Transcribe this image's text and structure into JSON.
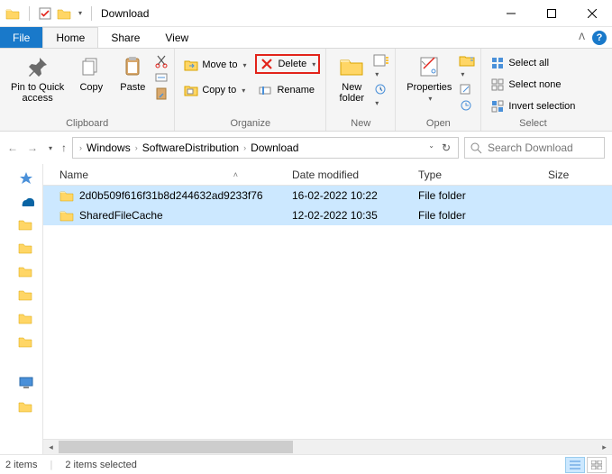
{
  "window": {
    "title": "Download"
  },
  "tabs": {
    "file": "File",
    "home": "Home",
    "share": "Share",
    "view": "View"
  },
  "ribbon": {
    "clipboard": {
      "label": "Clipboard",
      "pin": "Pin to Quick\naccess",
      "copy": "Copy",
      "paste": "Paste"
    },
    "organize": {
      "label": "Organize",
      "move_to": "Move to",
      "copy_to": "Copy to",
      "delete": "Delete",
      "rename": "Rename"
    },
    "new": {
      "label": "New",
      "new_folder": "New\nfolder"
    },
    "open": {
      "label": "Open",
      "properties": "Properties"
    },
    "select": {
      "label": "Select",
      "select_all": "Select all",
      "select_none": "Select none",
      "invert": "Invert selection"
    }
  },
  "breadcrumb": {
    "parts": [
      "Windows",
      "SoftwareDistribution",
      "Download"
    ]
  },
  "search": {
    "placeholder": "Search Download"
  },
  "columns": {
    "name": "Name",
    "date": "Date modified",
    "type": "Type",
    "size": "Size"
  },
  "rows": [
    {
      "name": "2d0b509f616f31b8d244632ad9233f76",
      "date": "16-02-2022 10:22",
      "type": "File folder"
    },
    {
      "name": "SharedFileCache",
      "date": "12-02-2022 10:35",
      "type": "File folder"
    }
  ],
  "status": {
    "count": "2 items",
    "selected": "2 items selected"
  }
}
